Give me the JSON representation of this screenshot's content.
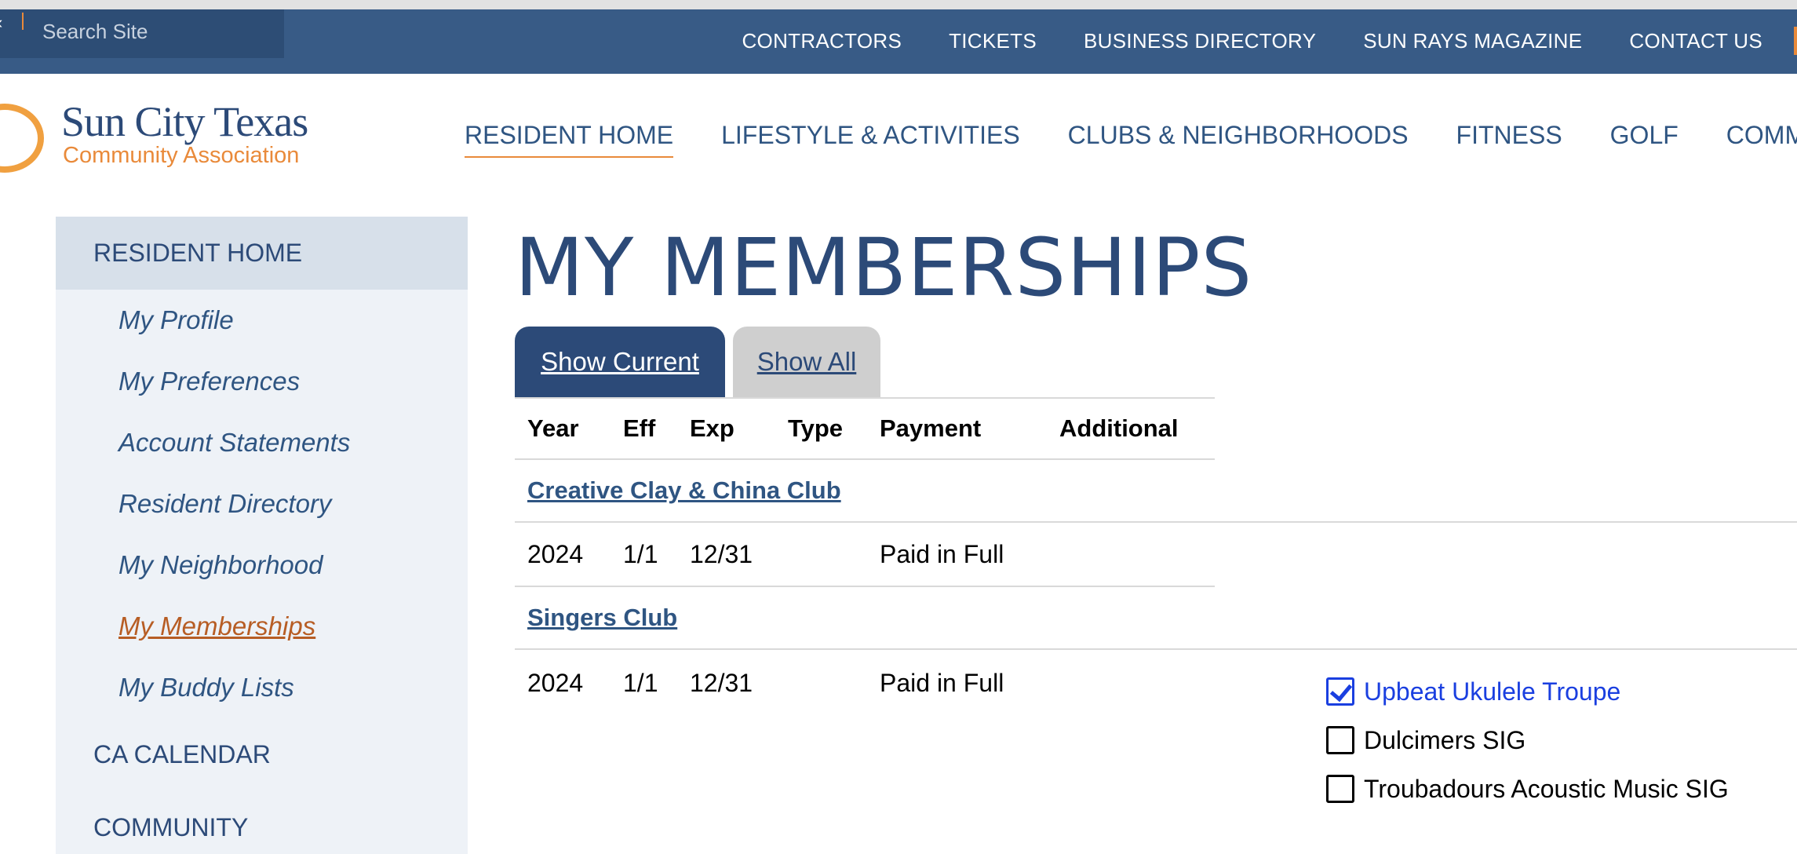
{
  "search": {
    "placeholder": "Search Site"
  },
  "utility_nav": [
    "CONTRACTORS",
    "TICKETS",
    "BUSINESS DIRECTORY",
    "SUN RAYS MAGAZINE",
    "CONTACT US"
  ],
  "logo": {
    "title": "Sun City Texas",
    "subtitle": "Community Association"
  },
  "main_nav": [
    "RESIDENT HOME",
    "LIFESTYLE & ACTIVITIES",
    "CLUBS & NEIGHBORHOODS",
    "FITNESS",
    "GOLF",
    "COMMUNIC"
  ],
  "sidebar": {
    "heading": "RESIDENT HOME",
    "items": [
      "My Profile",
      "My Preferences",
      "Account Statements",
      "Resident Directory",
      "My Neighborhood",
      "My Memberships",
      "My Buddy Lists"
    ],
    "active_item": "My Memberships",
    "sections": [
      "CA CALENDAR",
      "COMMUNITY"
    ]
  },
  "page": {
    "title": "MY MEMBERSHIPS",
    "tabs": {
      "current": "Show Current",
      "all": "Show All"
    }
  },
  "table": {
    "headers": {
      "year": "Year",
      "eff": "Eff",
      "exp": "Exp",
      "type": "Type",
      "payment": "Payment",
      "additional": "Additional"
    },
    "clubs": [
      {
        "name": "Creative Clay & China Club",
        "year": "2024",
        "eff": "1/1",
        "exp": "12/31",
        "type": "",
        "payment": "Paid in Full"
      },
      {
        "name": "Singers Club",
        "year": "2024",
        "eff": "1/1",
        "exp": "12/31",
        "type": "",
        "payment": "Paid in Full",
        "sigs": [
          {
            "label": "Upbeat Ukulele Troupe",
            "checked": true
          },
          {
            "label": "Dulcimers SIG",
            "checked": false
          },
          {
            "label": "Troubadours Acoustic Music SIG",
            "checked": false
          }
        ]
      }
    ]
  },
  "colors": {
    "navy": "#2c4a78",
    "utility_bar": "#385b86",
    "accent_orange": "#e98a3a",
    "checkbox_blue": "#1a3fe0"
  }
}
